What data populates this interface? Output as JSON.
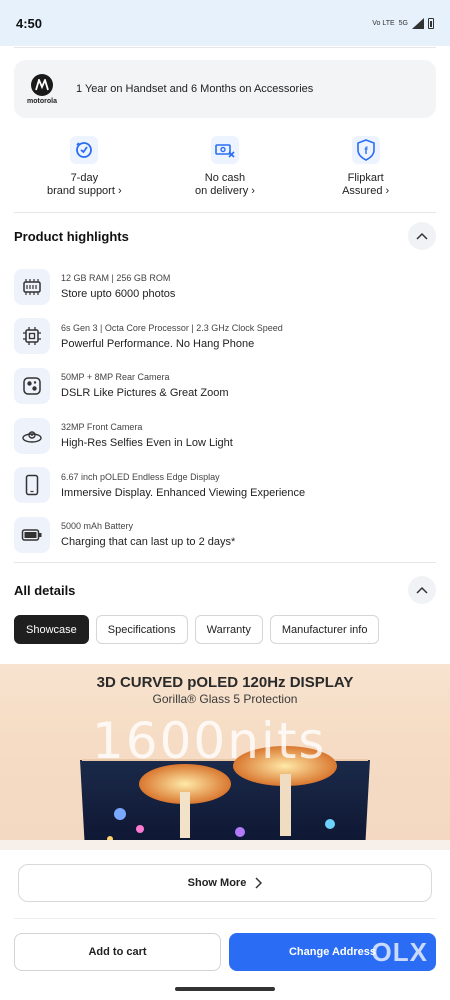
{
  "status_bar": {
    "time": "4:50",
    "network": "5G",
    "carrier": "Vo LTE"
  },
  "warranty": {
    "brand": "motorola",
    "text": "1 Year on Handset and 6 Months on Accessories"
  },
  "badges": [
    {
      "line1": "7-day",
      "line2": "brand support ›",
      "icon": "brand-support-icon"
    },
    {
      "line1": "No cash",
      "line2": "on delivery ›",
      "icon": "no-cash-icon"
    },
    {
      "line1": "Flipkart",
      "line2": "Assured ›",
      "icon": "flipkart-assured-icon"
    }
  ],
  "highlights": {
    "title": "Product highlights",
    "items": [
      {
        "small": "12 GB RAM | 256 GB ROM",
        "main": "Store upto 6000 photos",
        "icon": "memory-icon"
      },
      {
        "small": "6s Gen 3 | Octa Core Processor | 2.3 GHz Clock Speed",
        "main": "Powerful Performance. No Hang Phone",
        "icon": "processor-icon"
      },
      {
        "small": "50MP + 8MP Rear Camera",
        "main": "DSLR Like Pictures & Great Zoom",
        "icon": "rear-camera-icon"
      },
      {
        "small": "32MP Front Camera",
        "main": "High-Res Selfies Even in Low Light",
        "icon": "front-camera-icon"
      },
      {
        "small": "6.67 inch pOLED Endless Edge Display",
        "main": "Immersive Display. Enhanced Viewing Experience",
        "icon": "display-icon"
      },
      {
        "small": "5000 mAh Battery",
        "main": "Charging that can last up to 2 days*",
        "icon": "battery-icon"
      }
    ]
  },
  "all_details": {
    "title": "All details",
    "tabs": [
      "Showcase",
      "Specifications",
      "Warranty",
      "Manufacturer info"
    ],
    "active_tab": "Showcase"
  },
  "banner": {
    "headline": "3D CURVED pOLED 120Hz DISPLAY",
    "subline": "Gorilla® Glass 5 Protection",
    "nits": "1600nits"
  },
  "show_more": "Show More",
  "actions": {
    "add_to_cart": "Add to cart",
    "change_address": "Change Address",
    "watermark": "OLX"
  },
  "colors": {
    "accent": "#2a6df4",
    "active_tab": "#1f1f1f",
    "status_bar_bg": "#e6f1fb"
  }
}
